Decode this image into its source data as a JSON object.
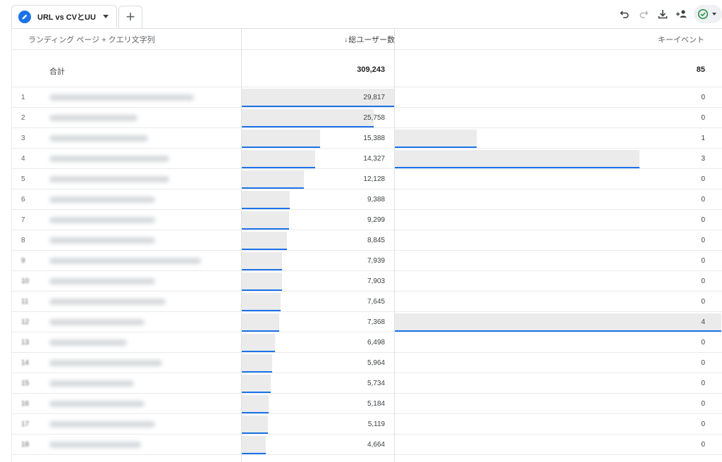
{
  "tab": {
    "label": "URL vs CVとUU",
    "add_label": "+"
  },
  "toolbar": {
    "icons": [
      "undo-icon",
      "redo-icon",
      "download-icon",
      "share-users-icon",
      "check-circle-icon"
    ]
  },
  "colors": {
    "accent": "#1a73e8",
    "bar_fill": "#ebebeb",
    "check": "#1e8e3e"
  },
  "table": {
    "headers": {
      "dimension": "ランディング ページ + クエリ文字列",
      "sort_arrow": "↓",
      "users": "総ユーザー数",
      "key_events": "キーイベント"
    },
    "total": {
      "label": "合計",
      "users": "309,243",
      "key_events": "85"
    },
    "rows": [
      {
        "num": "1",
        "users": "29,817",
        "key_events": "0",
        "users_fraction": 1.0,
        "kev_fraction": 0
      },
      {
        "num": "2",
        "users": "25,758",
        "key_events": "0",
        "users_fraction": 0.864,
        "kev_fraction": 0
      },
      {
        "num": "3",
        "users": "15,388",
        "key_events": "1",
        "users_fraction": 0.516,
        "kev_fraction": 0.25
      },
      {
        "num": "4",
        "users": "14,327",
        "key_events": "3",
        "users_fraction": 0.48,
        "kev_fraction": 0.75
      },
      {
        "num": "5",
        "users": "12,128",
        "key_events": "0",
        "users_fraction": 0.407,
        "kev_fraction": 0
      },
      {
        "num": "6",
        "users": "9,388",
        "key_events": "0",
        "users_fraction": 0.315,
        "kev_fraction": 0
      },
      {
        "num": "7",
        "users": "9,299",
        "key_events": "0",
        "users_fraction": 0.312,
        "kev_fraction": 0
      },
      {
        "num": "8",
        "users": "8,845",
        "key_events": "0",
        "users_fraction": 0.297,
        "kev_fraction": 0
      },
      {
        "num": "9",
        "users": "7,939",
        "key_events": "0",
        "users_fraction": 0.266,
        "kev_fraction": 0
      },
      {
        "num": "10",
        "users": "7,903",
        "key_events": "0",
        "users_fraction": 0.265,
        "kev_fraction": 0
      },
      {
        "num": "11",
        "users": "7,645",
        "key_events": "0",
        "users_fraction": 0.256,
        "kev_fraction": 0
      },
      {
        "num": "12",
        "users": "7,368",
        "key_events": "4",
        "users_fraction": 0.247,
        "kev_fraction": 1.0
      },
      {
        "num": "13",
        "users": "6,498",
        "key_events": "0",
        "users_fraction": 0.218,
        "kev_fraction": 0
      },
      {
        "num": "14",
        "users": "5,964",
        "key_events": "0",
        "users_fraction": 0.2,
        "kev_fraction": 0
      },
      {
        "num": "15",
        "users": "5,734",
        "key_events": "0",
        "users_fraction": 0.192,
        "kev_fraction": 0
      },
      {
        "num": "16",
        "users": "5,184",
        "key_events": "0",
        "users_fraction": 0.174,
        "kev_fraction": 0
      },
      {
        "num": "17",
        "users": "5,119",
        "key_events": "0",
        "users_fraction": 0.172,
        "kev_fraction": 0
      },
      {
        "num": "18",
        "users": "4,664",
        "key_events": "0",
        "users_fraction": 0.156,
        "kev_fraction": 0
      }
    ]
  }
}
